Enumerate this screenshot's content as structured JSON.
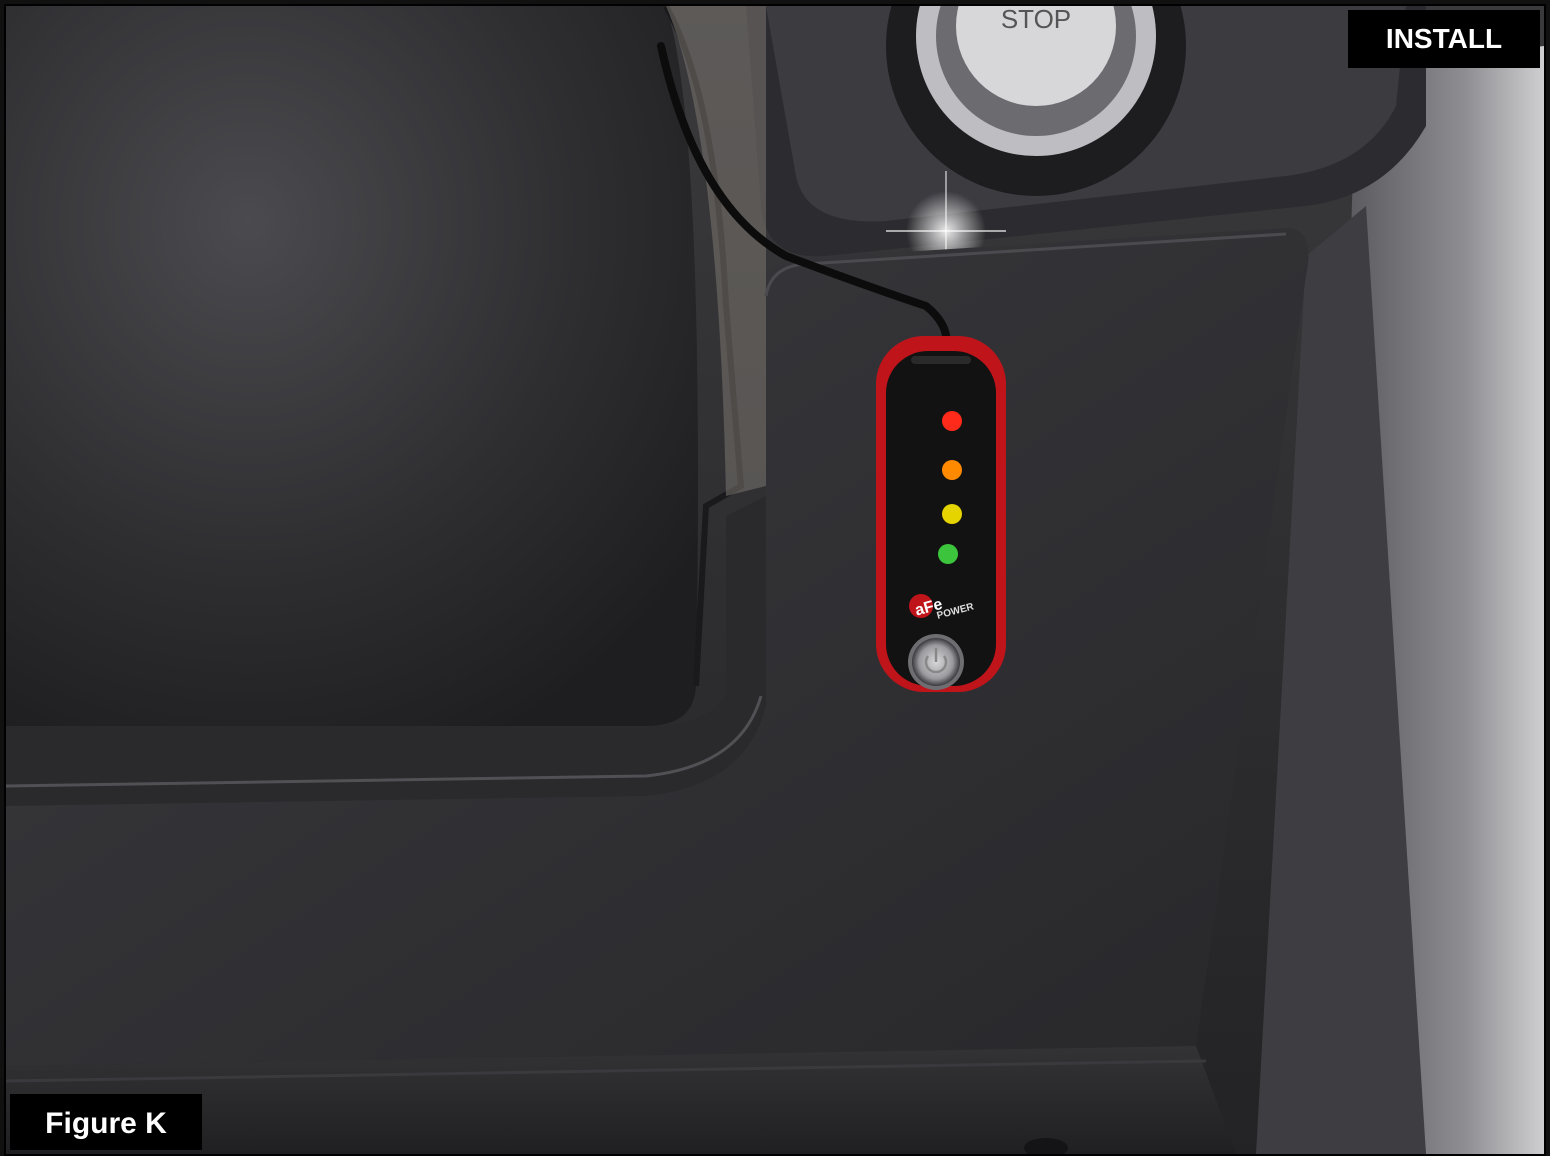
{
  "install_label": "INSTALL",
  "figure_label": "Figure K",
  "ignition": {
    "button_text": "STOP"
  },
  "module": {
    "brand": "aFe",
    "brand_sub": "POWER",
    "led_colors": [
      "#ff2a1a",
      "#ff8a00",
      "#e6d400",
      "#3cc43c"
    ]
  }
}
